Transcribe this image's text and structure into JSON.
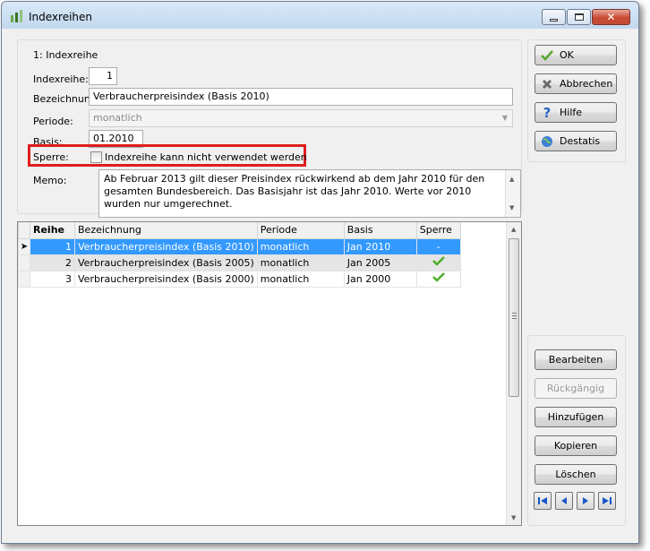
{
  "window": {
    "title": "Indexreihen",
    "accent": "#c2d8ef",
    "close_color": "#c84a35"
  },
  "form": {
    "section_label": "1: Indexreihe",
    "indexreihe": {
      "label": "Indexreihe:",
      "value": "1"
    },
    "bezeichnung": {
      "label": "Bezeichnung:",
      "value": "Verbraucherpreisindex (Basis 2010)"
    },
    "periode": {
      "label": "Periode:",
      "value": "monatlich"
    },
    "basis": {
      "label": "Basis:",
      "value": "01.2010"
    },
    "sperre": {
      "label": "Sperre:",
      "checkbox_label": "Indexreihe kann nicht verwendet werden",
      "checked": false
    },
    "memo": {
      "label": "Memo:",
      "value": "Ab Februar 2013 gilt dieser Preisindex rückwirkend ab dem Jahr 2010 für den gesamten Bundesbereich. Das Basisjahr ist das Jahr 2010. Werte vor 2010 wurden nur umgerechnet."
    },
    "highlight_color": "#e01d1d"
  },
  "buttons_top": [
    {
      "label": "OK",
      "icon": "check-icon"
    },
    {
      "label": "Abbrechen",
      "icon": "cancel-x-icon"
    },
    {
      "label": "Hilfe",
      "icon": "help-icon"
    },
    {
      "label": "Destatis",
      "icon": "globe-icon"
    }
  ],
  "buttons_bottom": [
    {
      "label": "Bearbeiten",
      "enabled": true
    },
    {
      "label": "Rückgängig",
      "enabled": false
    },
    {
      "label": "Hinzufügen",
      "enabled": true
    },
    {
      "label": "Kopieren",
      "enabled": true
    },
    {
      "label": "Löschen",
      "enabled": true
    }
  ],
  "navigation": [
    "first-record-icon",
    "previous-record-icon",
    "next-record-icon",
    "last-record-icon"
  ],
  "grid": {
    "columns": [
      "Reihe",
      "Bezeichnung",
      "Periode",
      "Basis",
      "Sperre"
    ],
    "rows": [
      {
        "reihe": "1",
        "bezeichnung": "Verbraucherpreisindex (Basis 2010)",
        "periode": "monatlich",
        "basis": "Jan 2010",
        "sperre": "-",
        "selected": true
      },
      {
        "reihe": "2",
        "bezeichnung": "Verbraucherpreisindex (Basis 2005)",
        "periode": "monatlich",
        "basis": "Jan 2005",
        "sperre": "check-icon",
        "selected": false
      },
      {
        "reihe": "3",
        "bezeichnung": "Verbraucherpreisindex (Basis 2000)",
        "periode": "monatlich",
        "basis": "Jan 2000",
        "sperre": "check-icon",
        "selected": false
      }
    ],
    "selection_color": "#3399ff"
  }
}
